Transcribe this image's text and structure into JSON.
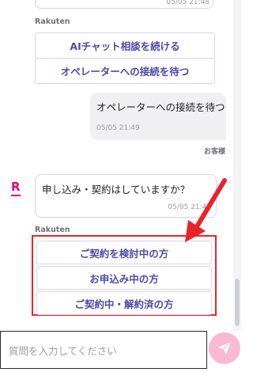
{
  "chat": {
    "prev_bubble": {
      "time": "05/05 21:48"
    },
    "block1": {
      "sender": "Rakuten",
      "options": [
        "AIチャット相談を続ける",
        "オペレーターへの接続を待つ"
      ]
    },
    "user_message": {
      "text": "オペレーターへの接続を待つ",
      "time": "05/05 21:49",
      "label": "お客様"
    },
    "bot_message": {
      "avatar": "R",
      "text": "申し込み・契約はしていますか？",
      "time": "05/05 21:49"
    },
    "block2": {
      "sender": "Rakuten",
      "options": [
        "ご契約を検討中の方",
        "お申込み中の方",
        "ご契約中・解約済の方"
      ]
    }
  },
  "composer": {
    "placeholder": "質問を入力してください",
    "send_icon": "paper-plane-icon"
  },
  "colors": {
    "accent": "#4d4ba8",
    "brand": "#e8007a",
    "highlight": "#e8242b",
    "send_button": "#f7bad0"
  }
}
